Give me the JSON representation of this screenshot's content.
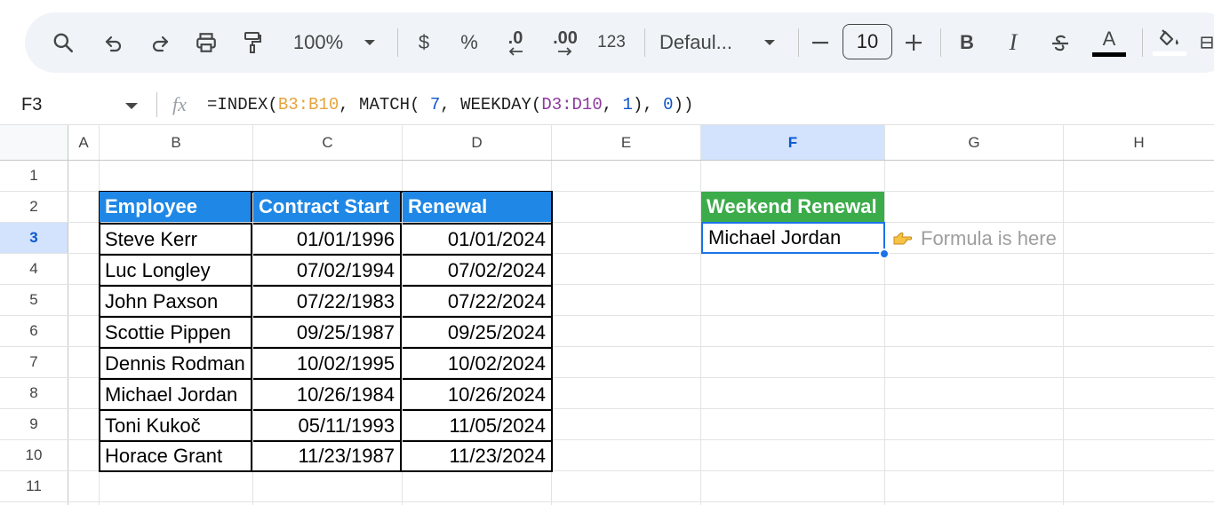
{
  "toolbar": {
    "zoom": "100%",
    "currency": "$",
    "percent": "%",
    "decrease_decimal": ".0",
    "increase_decimal": ".00",
    "number_format": "123",
    "font": "Defaul...",
    "font_size": "10",
    "minus": "—",
    "plus": "+",
    "bold": "B",
    "italic": "I",
    "text_color": "A"
  },
  "formula_bar": {
    "cell_ref": "F3",
    "fx": "fx",
    "formula_parts": {
      "p1": "=INDEX(",
      "p2": "B3:B10",
      "p3": ", MATCH( ",
      "p4": "7",
      "p5": ", WEEKDAY(",
      "p6": "D3:D10",
      "p7": ", ",
      "p8": "1",
      "p9": "), ",
      "p10": "0",
      "p11": "))"
    }
  },
  "columns": [
    "A",
    "B",
    "C",
    "D",
    "E",
    "F",
    "G",
    "H"
  ],
  "rows": [
    "1",
    "2",
    "3",
    "4",
    "5",
    "6",
    "7",
    "8",
    "9",
    "10",
    "11"
  ],
  "table": {
    "headers": [
      "Employee",
      "Contract Start",
      "Renewal"
    ],
    "rows": [
      [
        "Steve Kerr",
        "01/01/1996",
        "01/01/2024"
      ],
      [
        "Luc Longley",
        "07/02/1994",
        "07/02/2024"
      ],
      [
        "John Paxson",
        "07/22/1983",
        "07/22/2024"
      ],
      [
        "Scottie Pippen",
        "09/25/1987",
        "09/25/2024"
      ],
      [
        "Dennis Rodman",
        "10/02/1995",
        "10/02/2024"
      ],
      [
        "Michael Jordan",
        "10/26/1984",
        "10/26/2024"
      ],
      [
        "Toni Kukoč",
        "05/11/1993",
        "11/05/2024"
      ],
      [
        "Horace Grant",
        "11/23/1987",
        "11/23/2024"
      ]
    ]
  },
  "result": {
    "header": "Weekend Renewal",
    "value": "Michael Jordan",
    "note_icon": "pointing-hand",
    "note": "Formula is here"
  },
  "colors": {
    "header_blue": "#1f87e5",
    "header_green": "#3cab4a",
    "selection": "#1a73e8",
    "range_orange": "#e8a33d",
    "range_purple": "#8e3a9d",
    "number_blue": "#1155cc"
  }
}
